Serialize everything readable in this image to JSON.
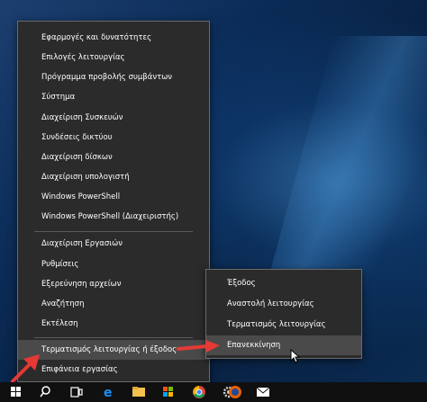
{
  "main_menu": {
    "items": [
      "Εφαρμογές και δυνατότητες",
      "Επιλογές λειτουργίας",
      "Πρόγραμμα προβολής συμβάντων",
      "Σύστημα",
      "Διαχείριση Συσκευών",
      "Συνδέσεις δικτύου",
      "Διαχείριση δίσκων",
      "Διαχείριση υπολογιστή",
      "Windows PowerShell",
      "Windows PowerShell (Διαχειριστής)",
      "Διαχείριση Εργασιών",
      "Ρυθμίσεις",
      "Εξερεύνηση αρχείων",
      "Αναζήτηση",
      "Εκτέλεση",
      "Τερματισμός λειτουργίας ή έξοδος",
      "Επιφάνεια εργασίας"
    ]
  },
  "sub_menu": {
    "items": [
      "Έξοδος",
      "Αναστολή λειτουργίας",
      "Τερματισμός λειτουργίας",
      "Επανεκκίνηση"
    ]
  },
  "colors": {
    "annotation_arrow": "#e53935",
    "menu_background": "#2b2b2b",
    "highlight": "#4a4a4a"
  },
  "taskbar": {
    "icons": [
      "windows-start-icon",
      "search-icon",
      "task-view-icon",
      "edge-icon",
      "file-explorer-icon",
      "store-icon",
      "chrome-icon",
      "settings-icon",
      "firefox-icon",
      "mail-icon"
    ]
  }
}
